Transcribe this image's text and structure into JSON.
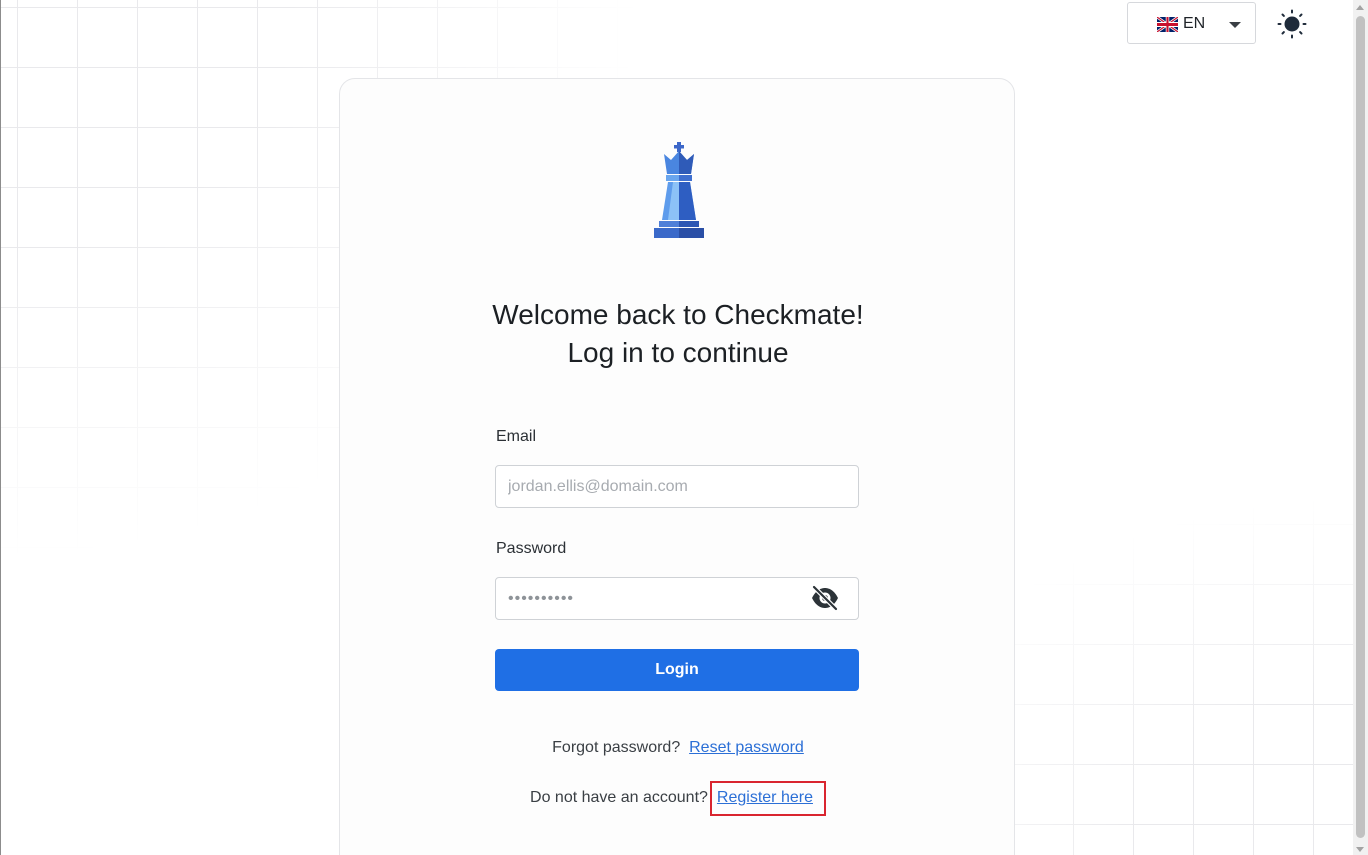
{
  "language": {
    "selected": "EN",
    "flag_icon": "uk-flag-icon"
  },
  "theme_toggle": {
    "icon": "sun-icon"
  },
  "logo": {
    "icon": "chess-queen-icon"
  },
  "heading": {
    "line1": "Welcome back to Checkmate!",
    "line2": "Log in to continue"
  },
  "form": {
    "email_label": "Email",
    "email_placeholder": "jordan.ellis@domain.com",
    "email_value": "",
    "password_label": "Password",
    "password_placeholder": "••••••••••",
    "password_value": "",
    "toggle_visibility_icon": "eye-off-icon",
    "login_label": "Login"
  },
  "forgot": {
    "text": "Forgot password?",
    "link": "Reset password"
  },
  "register": {
    "text": "Do not have an account?",
    "link": "Register here"
  },
  "colors": {
    "primary": "#1f6fe5",
    "link": "#2b6fd6",
    "highlight_box": "#d9252f"
  }
}
